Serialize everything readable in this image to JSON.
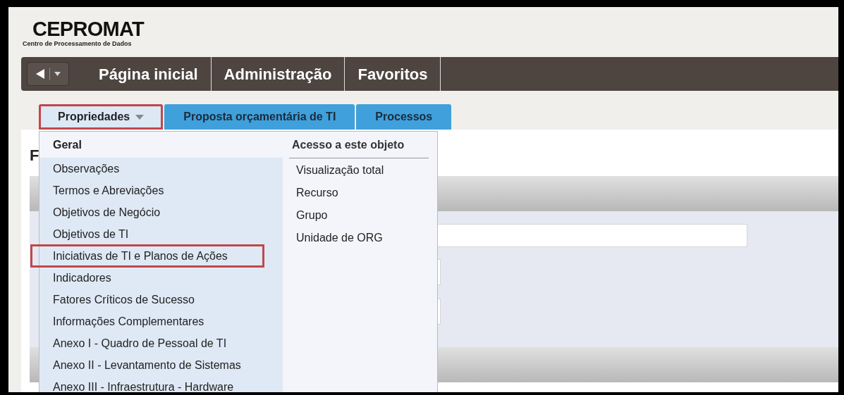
{
  "logo": {
    "title": "CEPROMAT",
    "subtitle": "Centro de Processamento de Dados"
  },
  "nav": {
    "items": [
      {
        "label": "Página inicial"
      },
      {
        "label": "Administração"
      },
      {
        "label": "Favoritos"
      }
    ]
  },
  "tabs": [
    {
      "label": "Propriedades",
      "selected": true,
      "dropdown": true,
      "highlighted": true
    },
    {
      "label": "Proposta orçamentária de TI",
      "selected": false,
      "dropdown": false,
      "highlighted": false
    },
    {
      "label": "Processos",
      "selected": false,
      "dropdown": false,
      "highlighted": false
    }
  ],
  "page_heading": "F",
  "menu": {
    "left_header": "Geral",
    "left_items": [
      {
        "label": "Observações",
        "highlighted": false
      },
      {
        "label": "Termos e Abreviações",
        "highlighted": false
      },
      {
        "label": "Objetivos de Negócio",
        "highlighted": false
      },
      {
        "label": "Objetivos de TI",
        "highlighted": false
      },
      {
        "label": "Iniciativas de TI e Planos de Ações",
        "highlighted": true
      },
      {
        "label": "Indicadores",
        "highlighted": false
      },
      {
        "label": "Fatores Críticos de Sucesso",
        "highlighted": false
      },
      {
        "label": "Informações Complementares",
        "highlighted": false
      },
      {
        "label": "Anexo I - Quadro de Pessoal de TI",
        "highlighted": false
      },
      {
        "label": "Anexo II - Levantamento de Sistemas",
        "highlighted": false
      },
      {
        "label": "Anexo III - Infraestrutura - Hardware",
        "highlighted": false
      }
    ],
    "right_header": "Acesso a este objeto",
    "right_items": [
      {
        "label": "Visualização total"
      },
      {
        "label": "Recurso"
      },
      {
        "label": "Grupo"
      },
      {
        "label": "Unidade de ORG"
      }
    ]
  }
}
